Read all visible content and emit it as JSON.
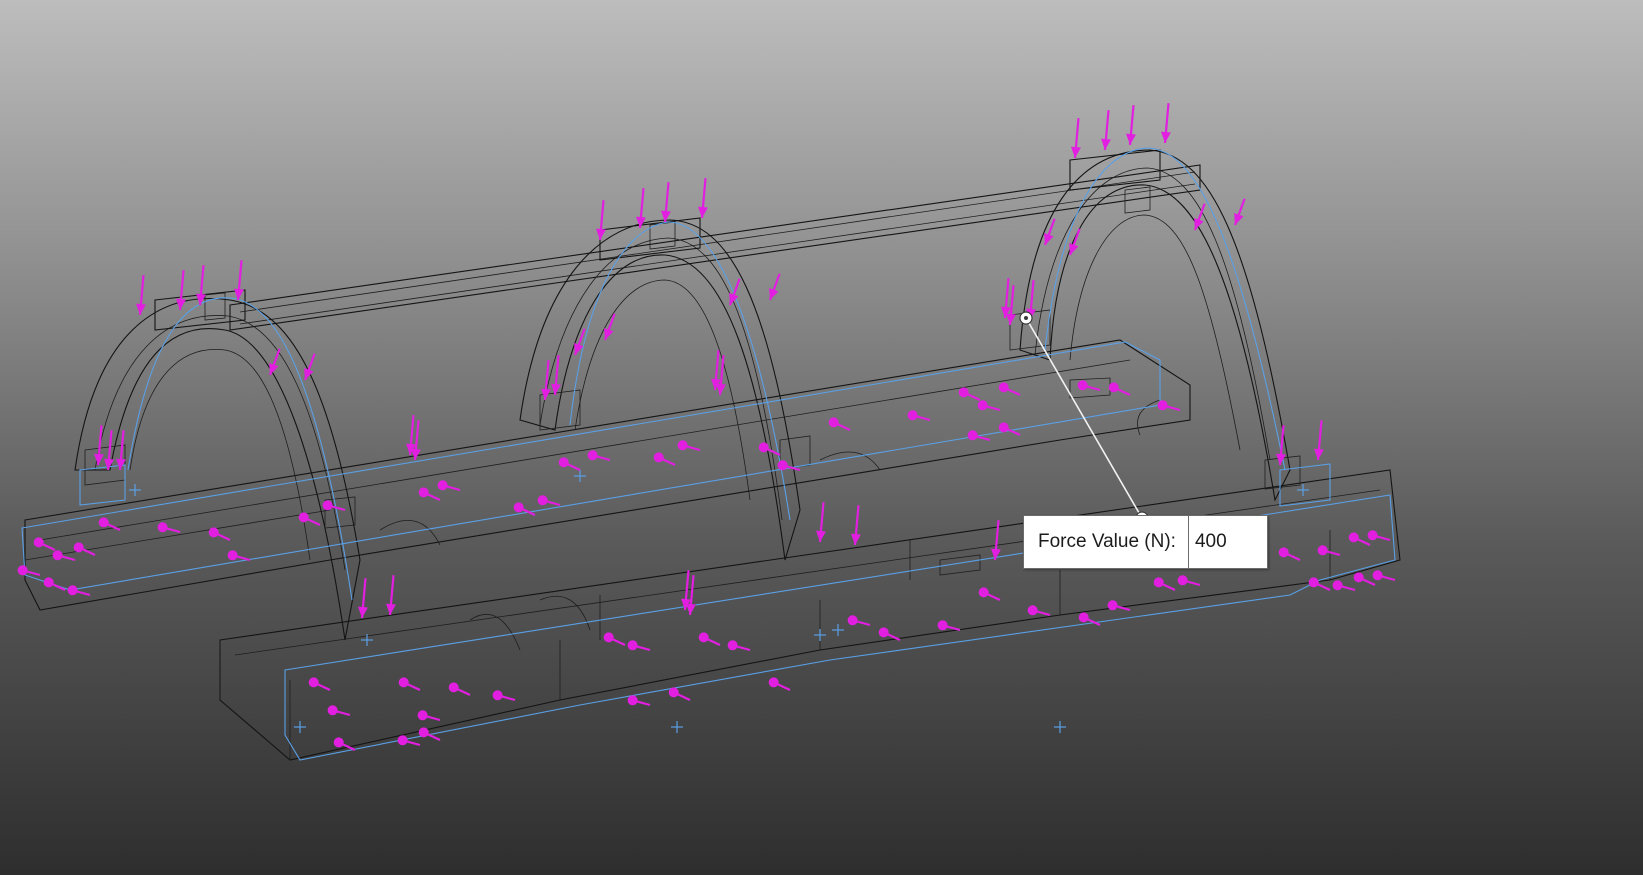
{
  "force_callout": {
    "label": "Force Value (N):",
    "value": "400"
  },
  "icons": {
    "force_arrow": "force-arrow-icon",
    "callout_handle": "drag-handle-icon",
    "origin_marker": "crosshair-icon"
  },
  "colors": {
    "background_top": "#bdbdbd",
    "background_bottom": "#2e2e2e",
    "edge": "#141414",
    "selected_face": "#5aa0e6",
    "force_arrow": "#e21fe0",
    "callout_leader": "#f2f2f2"
  }
}
